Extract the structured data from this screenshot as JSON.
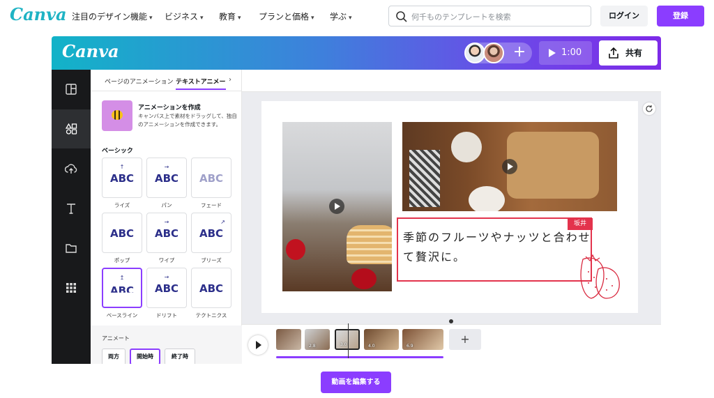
{
  "topnav": {
    "logo": "Canva",
    "items": [
      {
        "label": "注目のデザイン機能"
      },
      {
        "label": "ビジネス"
      },
      {
        "label": "教育"
      },
      {
        "label": "プランと価格"
      },
      {
        "label": "学ぶ"
      }
    ],
    "search_placeholder": "何千ものテンプレートを検索",
    "login": "ログイン",
    "register": "登録"
  },
  "editor": {
    "logo": "Canva",
    "duration": "1:00",
    "share": "共有",
    "add_collaborator": "+",
    "side_rail": [
      {
        "icon": "layout-icon"
      },
      {
        "icon": "elements-icon"
      },
      {
        "icon": "upload-icon"
      },
      {
        "icon": "text-icon"
      },
      {
        "icon": "folder-icon"
      },
      {
        "icon": "apps-icon"
      }
    ],
    "panel": {
      "tabs": [
        "ページのアニメーション",
        "テキストアニメー"
      ],
      "tab_more": "›",
      "create_title": "アニメーションを作成",
      "create_desc": "キャンバス上で素材をドラッグして、独自のアニメーションを作成できます。",
      "section": "ベーシック",
      "tiles": [
        {
          "label": "ライズ",
          "text": "ABC",
          "mark": "↑"
        },
        {
          "label": "パン",
          "text": "ABC",
          "mark": "→"
        },
        {
          "label": "フェード",
          "text": "ABC",
          "mark": ""
        },
        {
          "label": "ポップ",
          "text": "ABC",
          "mark": ""
        },
        {
          "label": "ワイプ",
          "text": "ABC",
          "mark": "→"
        },
        {
          "label": "ブリーズ",
          "text": "ABC",
          "mark": "↗"
        },
        {
          "label": "ベースライン",
          "text": "ABC",
          "mark": "↥"
        },
        {
          "label": "ドリフト",
          "text": "ABC",
          "mark": "→"
        },
        {
          "label": "テクトニクス",
          "text": "ABC",
          "mark": ""
        }
      ],
      "animate_title": "アニメート",
      "animate_buttons": [
        "両方",
        "開始時",
        "終了時"
      ]
    },
    "canvas": {
      "text": "季節のフルーツやナッツと合わせて贅沢に。",
      "tag": "坂井"
    },
    "timeline": {
      "clips": [
        {
          "label": ""
        },
        {
          "label": "2.8"
        },
        {
          "label": "3.0"
        },
        {
          "label": "4.0"
        },
        {
          "label": "6.9"
        }
      ],
      "add": "+"
    }
  },
  "cta": "動画を編集する"
}
